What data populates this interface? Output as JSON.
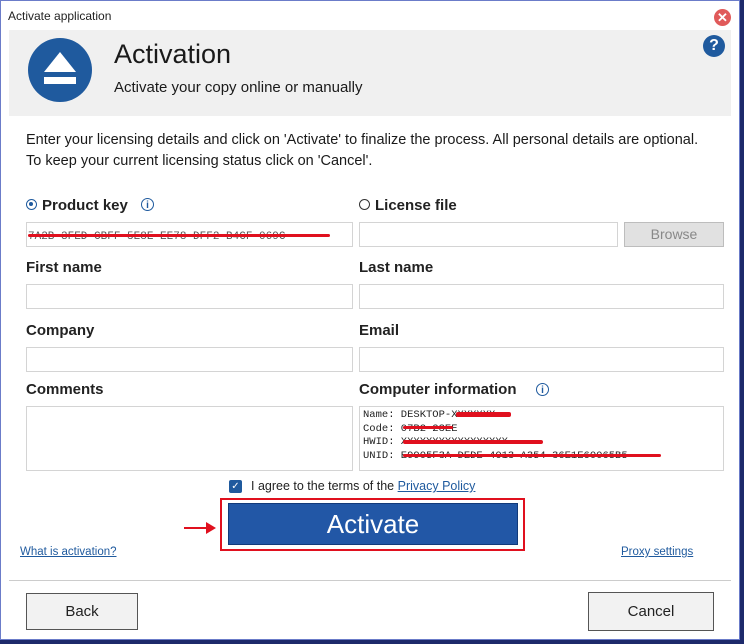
{
  "window": {
    "title": "Activate application",
    "close_glyph": "✕"
  },
  "header": {
    "title": "Activation",
    "subtitle": "Activate your copy online or manually",
    "help_glyph": "?"
  },
  "intro": "Enter your licensing details and click on 'Activate' to finalize the process. All personal details are optional. To keep your current licensing status click on 'Cancel'.",
  "license": {
    "product_key_label": "Product key",
    "product_key_value": "7A2B-3FED-CBFF-5E8E-EE78-DFF2-B4CF-069C",
    "license_file_label": "License file",
    "browse_label": "Browse",
    "selected": "product_key"
  },
  "fields": {
    "first_name_label": "First name",
    "last_name_label": "Last name",
    "company_label": "Company",
    "email_label": "Email",
    "comments_label": "Comments",
    "computer_info_label": "Computer information"
  },
  "computer_info": {
    "name": "Name: DESKTOP-XXXXXXX",
    "code": "Code: 07B2-23EE",
    "hwid": "HWID: XXXXXXXXXXXXXXXXX",
    "unid": "UNID: E9905F3A-DEDE-4013-A354-36E1E60065B5"
  },
  "agree": {
    "checked": true,
    "text": "I agree to the terms of the",
    "link": "Privacy Policy"
  },
  "buttons": {
    "activate": "Activate",
    "back": "Back",
    "cancel": "Cancel"
  },
  "links": {
    "what_is_activation": "What is activation?",
    "proxy_settings": "Proxy settings"
  },
  "colors": {
    "accent": "#1f5a9e",
    "highlight": "#e0101e",
    "activate_bg": "#2257a6"
  }
}
